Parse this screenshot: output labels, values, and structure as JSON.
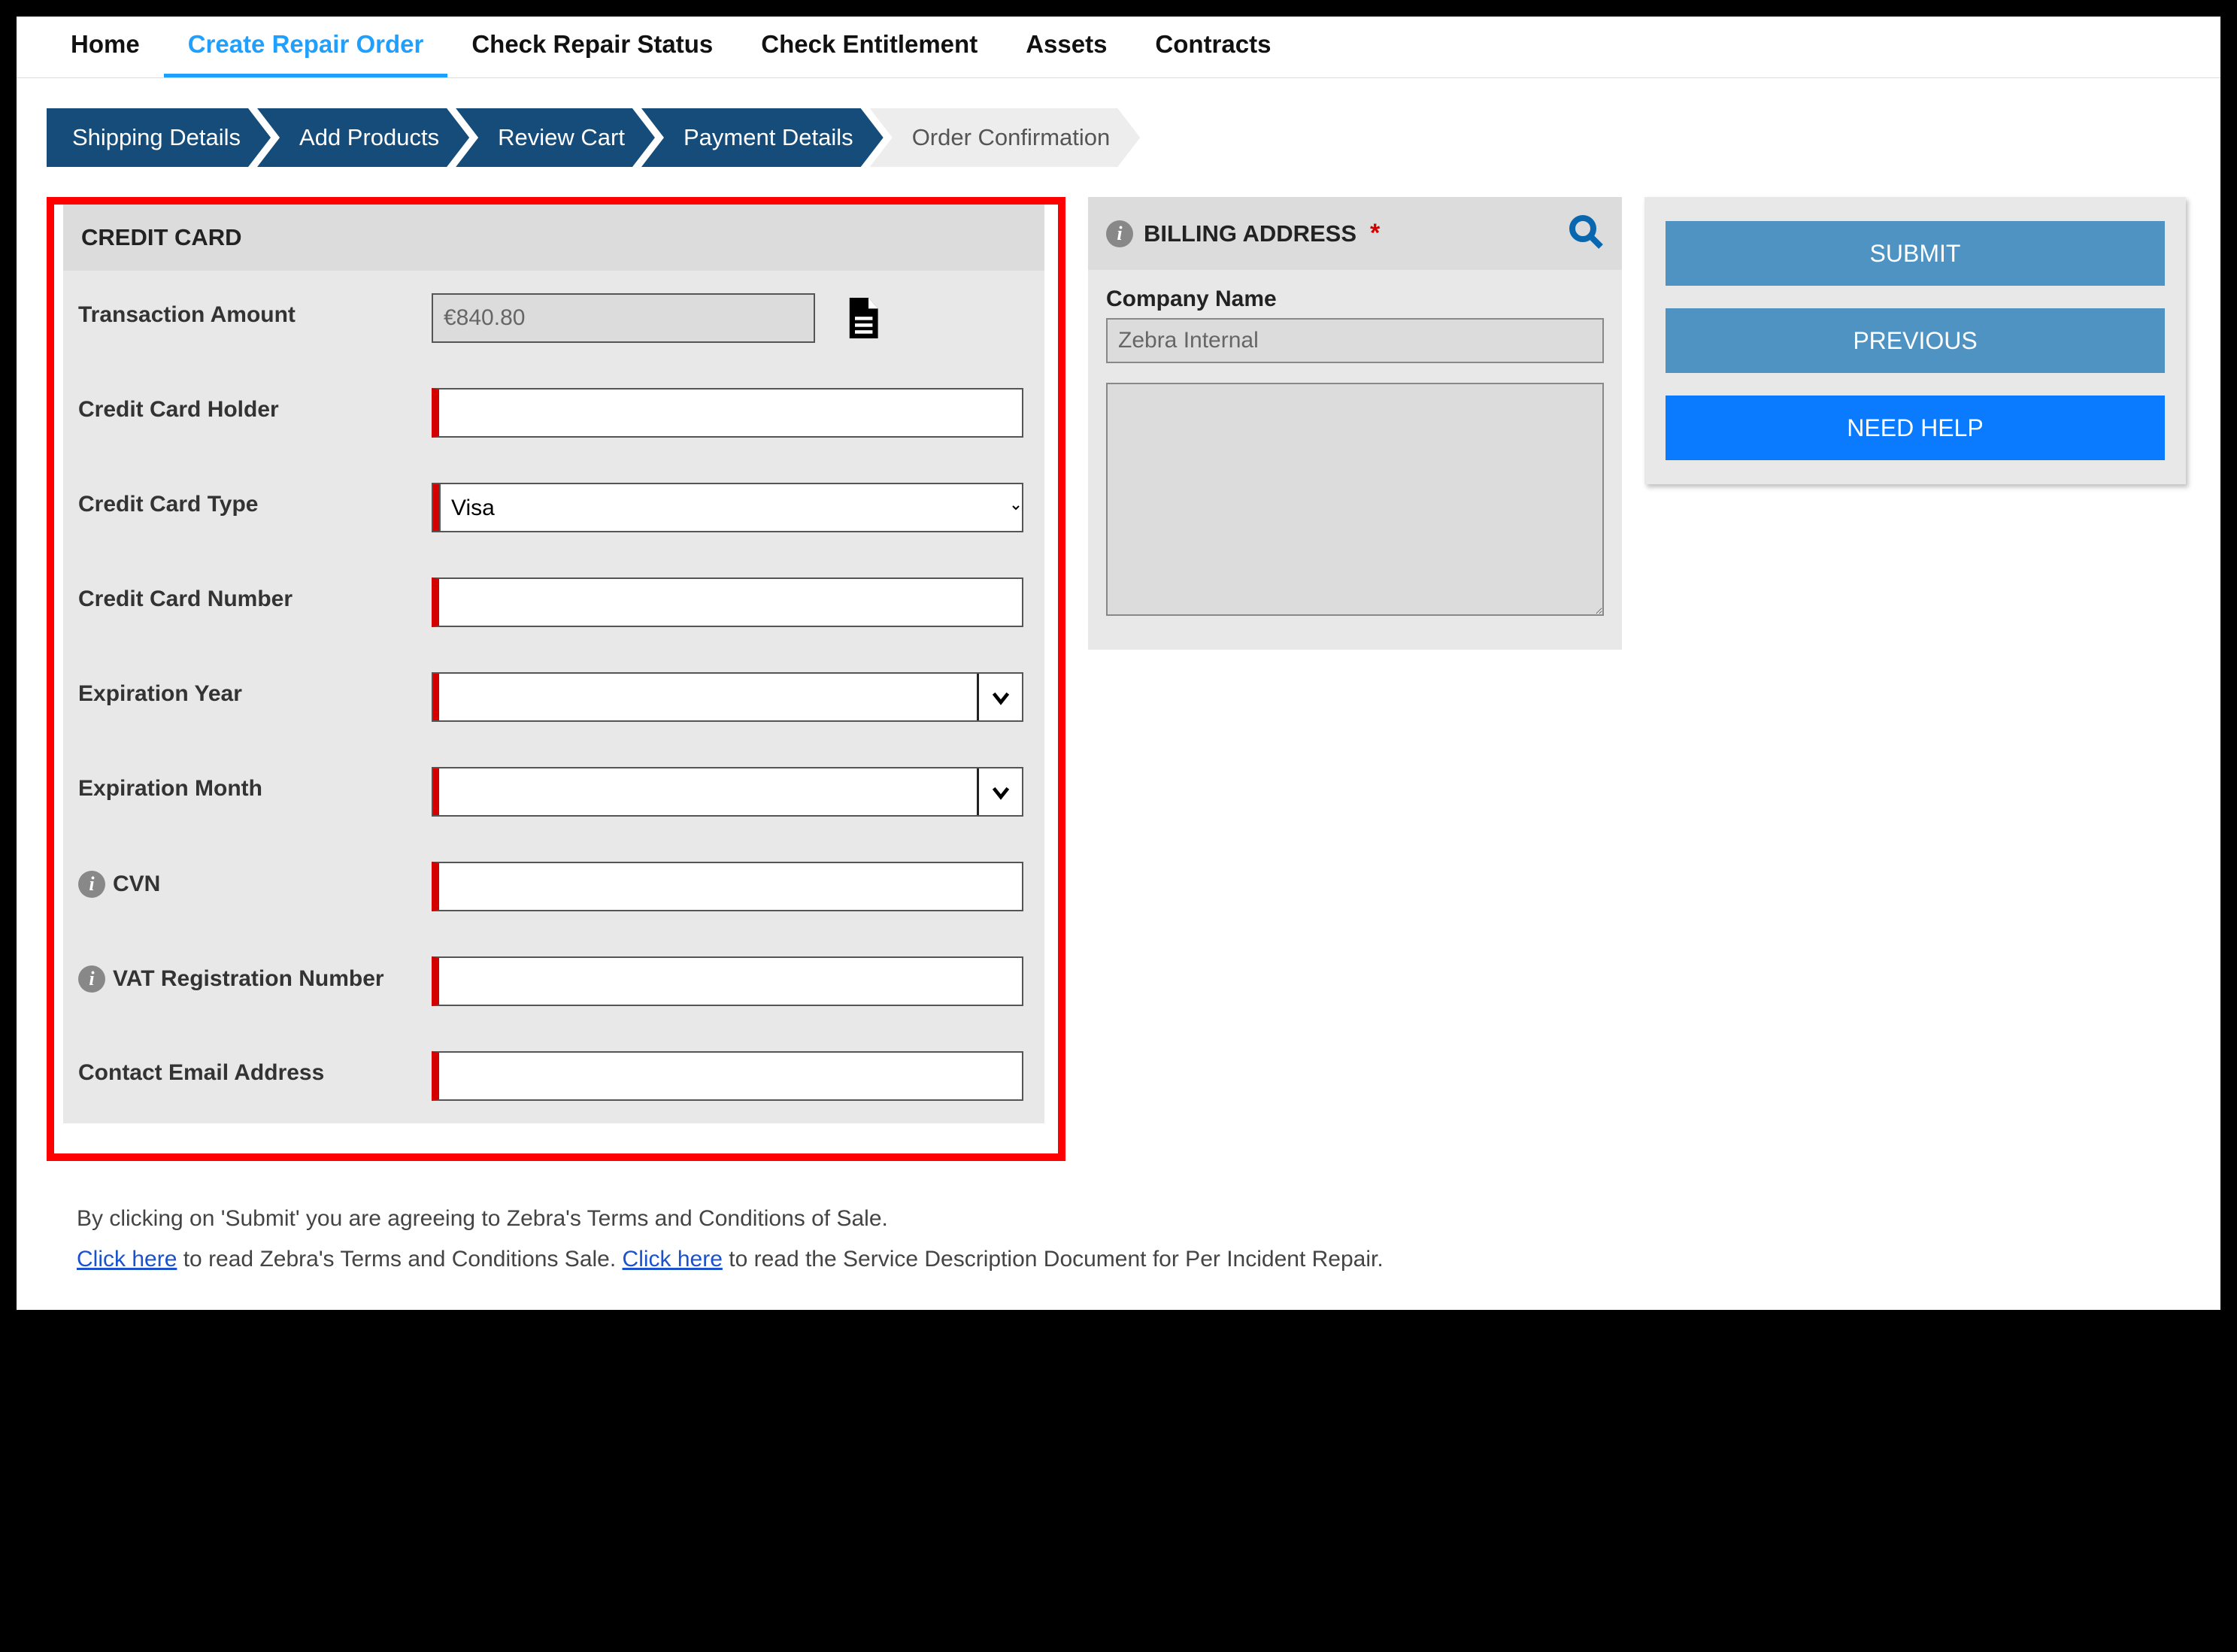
{
  "nav": {
    "home": "Home",
    "create_repair_order": "Create Repair Order",
    "check_repair_status": "Check Repair Status",
    "check_entitlement": "Check Entitlement",
    "assets": "Assets",
    "contracts": "Contracts"
  },
  "steps": {
    "shipping": "Shipping Details",
    "add_products": "Add Products",
    "review_cart": "Review Cart",
    "payment": "Payment Details",
    "confirm": "Order Confirmation"
  },
  "credit_card": {
    "header": "CREDIT CARD",
    "labels": {
      "amount": "Transaction Amount",
      "holder": "Credit Card Holder",
      "type": "Credit Card Type",
      "number": "Credit Card Number",
      "exp_year": "Expiration Year",
      "exp_month": "Expiration Month",
      "cvn": "CVN",
      "vat": "VAT Registration Number",
      "email": "Contact Email Address"
    },
    "values": {
      "amount": "€840.80",
      "holder": "",
      "type_selected": "Visa",
      "number": "",
      "exp_year": "",
      "exp_month": "",
      "cvn": "",
      "vat": "",
      "email": ""
    }
  },
  "billing": {
    "header": "BILLING ADDRESS",
    "company_label": "Company Name",
    "company_value": "Zebra Internal",
    "address_text": ""
  },
  "actions": {
    "submit": "SUBMIT",
    "previous": "PREVIOUS",
    "need_help": "NEED HELP"
  },
  "footer": {
    "line1": "By clicking on 'Submit' you are agreeing to Zebra's Terms and Conditions of Sale.",
    "click_here_1": "Click here",
    "mid1": " to read Zebra's Terms and Conditions Sale. ",
    "click_here_2": "Click here",
    "mid2": " to read the Service Description Document for Per Incident Repair."
  }
}
